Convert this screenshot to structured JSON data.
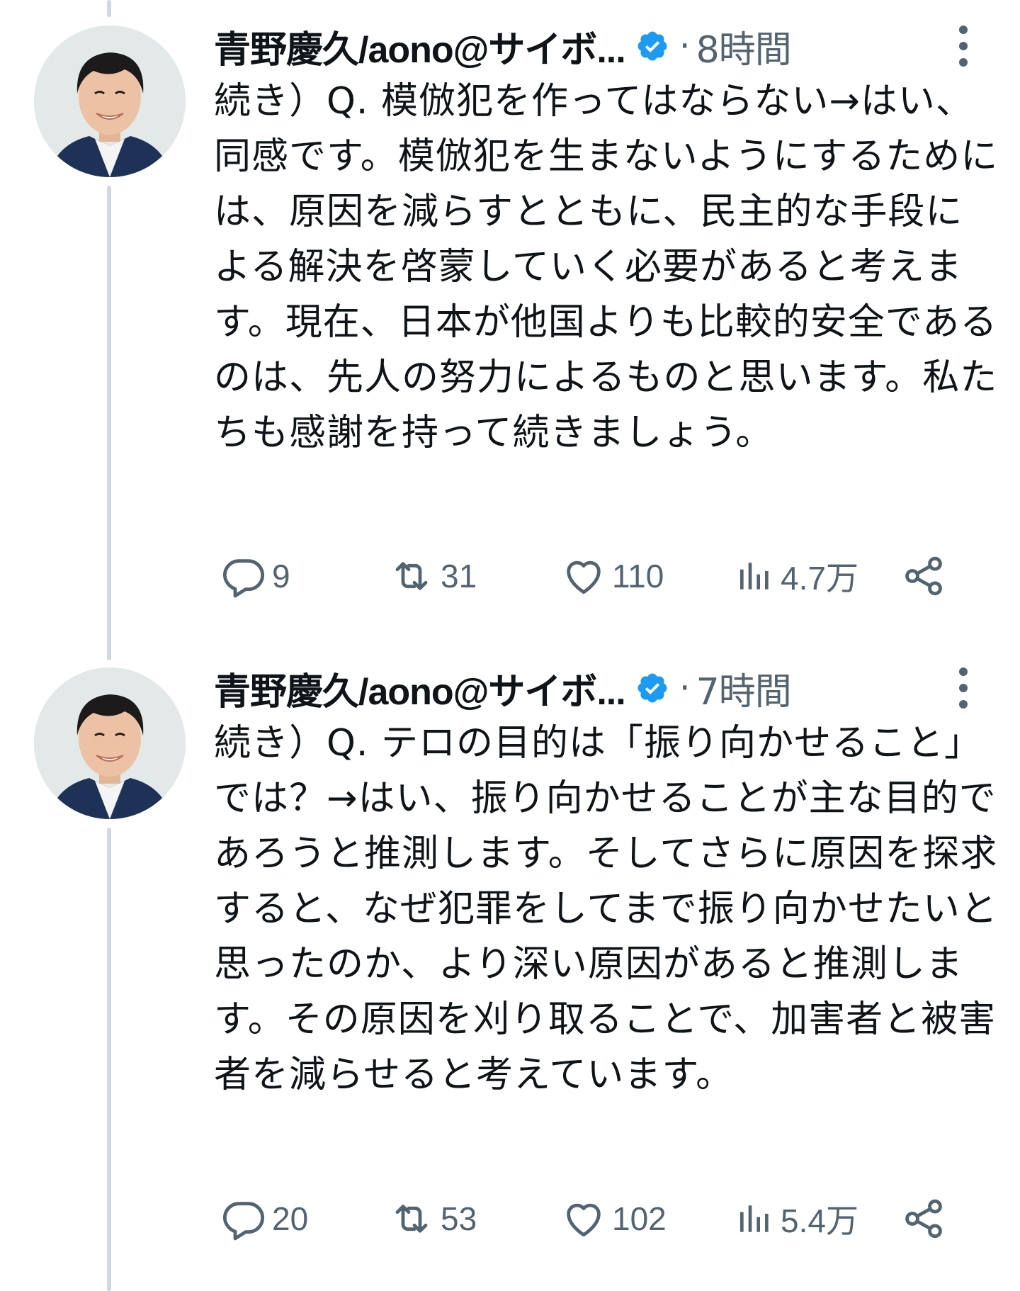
{
  "colors": {
    "text_primary": "#0f1419",
    "text_secondary": "#536471",
    "verified_blue": "#1d9bf0",
    "thread_line": "#cfd9de"
  },
  "tweets": [
    {
      "author_name": "青野慶久/aono@サイボ...",
      "verified_icon": "verified-badge-icon",
      "separator": "·",
      "time": "8時間",
      "text": "続き）Q. 模倣犯を作ってはならない→はい、同感です。模倣犯を生まないようにするためには、原因を減らすとともに、民主的な手段による解決を啓蒙していく必要があると考えます。現在、日本が他国よりも比較的安全であるのは、先人の努力によるものと思います。私たちも感謝を持って続きましょう。",
      "replies": "9",
      "retweets": "31",
      "likes": "110",
      "views": "4.7万"
    },
    {
      "author_name": "青野慶久/aono@サイボ...",
      "verified_icon": "verified-badge-icon",
      "separator": "·",
      "time": "7時間",
      "text": "続き）Q. テロの目的は「振り向かせること」では？→はい、振り向かせることが主な目的であろうと推測します。そしてさらに原因を探求すると、なぜ犯罪をしてまで振り向かせたいと思ったのか、より深い原因があると推測します。その原因を刈り取ることで、加害者と被害者を減らせると考えています。",
      "replies": "20",
      "retweets": "53",
      "likes": "102",
      "views": "5.4万"
    }
  ]
}
